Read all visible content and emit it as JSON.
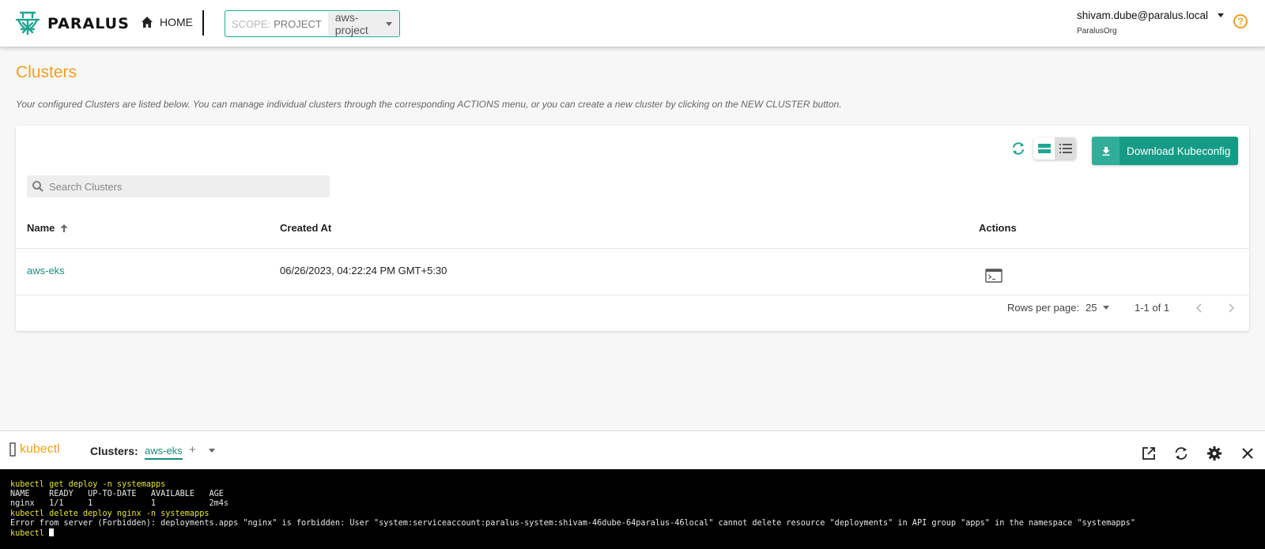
{
  "colors": {
    "accent": "#1fa692",
    "brand_orange": "#f0a020",
    "button": "#169c86",
    "link": "#1a8c7a"
  },
  "header": {
    "logo_text": "PARALUS",
    "home_label": "HOME",
    "scope_label": "SCOPE:",
    "scope_value": "PROJECT",
    "project": "aws-project",
    "user_email": "shivam.dube@paralus.local",
    "user_org": "ParalusOrg",
    "help_icon": "?"
  },
  "page": {
    "title": "Clusters",
    "description": "Your configured Clusters are listed below. You can manage individual clusters through the corresponding ACTIONS menu, or you can create a new cluster by clicking on the NEW CLUSTER button."
  },
  "toolbar": {
    "download_label": "Download Kubeconfig",
    "search_placeholder": "Search Clusters"
  },
  "table": {
    "columns": [
      "Name",
      "Created At",
      "Actions"
    ],
    "rows": [
      {
        "name": "aws-eks",
        "created_at": "06/26/2023, 04:22:24 PM GMT+5:30"
      }
    ]
  },
  "pagination": {
    "rows_per_page_label": "Rows per page:",
    "rows_per_page": "25",
    "range": "1-1 of 1"
  },
  "kubectl": {
    "title": "kubectl",
    "clusters_label": "Clusters:",
    "active_cluster": "aws-eks",
    "add_symbol": "+",
    "terminal": {
      "line1": "kubectl get deploy -n systemapps",
      "line2": "NAME    READY   UP-TO-DATE   AVAILABLE   AGE",
      "line3": "nginx   1/1     1            1           2m4s",
      "line4": "kubectl delete deploy nginx -n systemapps",
      "line5": "Error from server (Forbidden): deployments.apps \"nginx\" is forbidden: User \"system:serviceaccount:paralus-system:shivam-46dube-64paralus-46local\" cannot delete resource \"deployments\" in API group \"apps\" in the namespace \"systemapps\"",
      "prompt": "kubectl "
    }
  }
}
